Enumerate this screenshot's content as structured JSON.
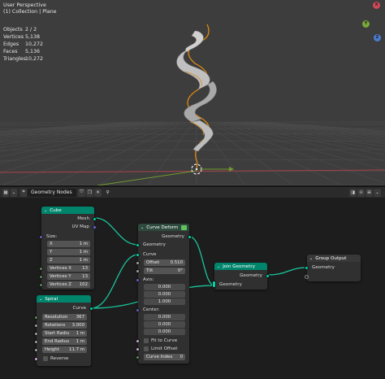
{
  "viewport": {
    "view_name": "User Perspective",
    "collection_path": "(1) Collection | Plane",
    "stats": [
      {
        "label": "Objects",
        "value": "2 / 2"
      },
      {
        "label": "Vertices",
        "value": "5,138"
      },
      {
        "label": "Edges",
        "value": "10,272"
      },
      {
        "label": "Faces",
        "value": "5,136"
      },
      {
        "label": "Triangles",
        "value": "10,272"
      }
    ],
    "gizmo": {
      "x_label": "X",
      "y_label": "Y",
      "z_label": "Z"
    },
    "colors": {
      "background": "#3d3d3d",
      "grid": "#474747",
      "x_axis": "#a8414a",
      "y_axis": "#6e9a2c",
      "ribbon": "#b3b3b3",
      "curve": "#e8900f"
    }
  },
  "node_editor": {
    "tree_name": "Geometry Nodes",
    "colors": {
      "background": "#1d1d1d",
      "link": "#1ac59c",
      "geometry_header": "#00846b"
    },
    "nodes": {
      "cube": {
        "title": "Cube",
        "outputs": {
          "mesh": "Mesh",
          "uv_map": "UV Map"
        },
        "size_label": "Size:",
        "size_fields": [
          {
            "label": "X",
            "value": "1 m"
          },
          {
            "label": "Y",
            "value": "1 m"
          },
          {
            "label": "Z",
            "value": "1 m"
          }
        ],
        "vertex_fields": [
          {
            "label": "Vertices X",
            "value": "13"
          },
          {
            "label": "Vertices Y",
            "value": "13"
          },
          {
            "label": "Vertices Z",
            "value": "102"
          }
        ]
      },
      "spiral": {
        "title": "Spiral",
        "output": "Curve",
        "fields": [
          {
            "label": "Resolution",
            "value": "367"
          },
          {
            "label": "Rotations",
            "value": "3.000"
          },
          {
            "label": "Start Radiu",
            "value": "1 m"
          },
          {
            "label": "End Radius",
            "value": "1 m"
          },
          {
            "label": "Height",
            "value": "11.7 m"
          }
        ],
        "reverse_label": "Reverse"
      },
      "curve_deform": {
        "title": "Curve Deform",
        "output": "Geometry",
        "inputs": {
          "geometry": "Geometry",
          "curve": "Curve"
        },
        "offset": {
          "label": "Offset",
          "value": "0.510"
        },
        "tilt": {
          "label": "Tilt",
          "value": "0°"
        },
        "axis_label": "Axis:",
        "axis_values": [
          "0.000",
          "0.000",
          "1.000"
        ],
        "center_label": "Center:",
        "center_values": [
          "0.000",
          "0.000",
          "0.000"
        ],
        "fit_to_curve": "Fit to Curve",
        "limit_offset": "Limit Offset",
        "curve_index": {
          "label": "Curve Index",
          "value": "0"
        }
      },
      "join_geometry": {
        "title": "Join Geometry",
        "output": "Geometry",
        "input": "Geometry"
      },
      "group_output": {
        "title": "Group Output",
        "input": "Geometry"
      }
    }
  }
}
